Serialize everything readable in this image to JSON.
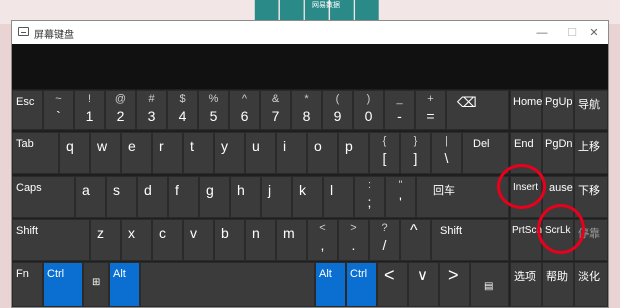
{
  "window": {
    "title": "屏幕键盘"
  },
  "backdrop": {
    "caption": "网易数据"
  },
  "icons": {
    "minimize": "minimize-icon",
    "maximize": "maximize-icon",
    "close": "close-icon",
    "backspace": "backspace-icon",
    "windows": "windows-logo-icon",
    "menu": "menu-icon"
  },
  "keys": {
    "esc": "Esc",
    "k1_top": "~",
    "k1_bot": "`",
    "k2_top": "!",
    "k2_bot": "1",
    "k3_top": "@",
    "k3_bot": "2",
    "k4_top": "#",
    "k4_bot": "3",
    "k5_top": "$",
    "k5_bot": "4",
    "k6_top": "%",
    "k6_bot": "5",
    "k7_top": "^",
    "k7_bot": "6",
    "k8_top": "&",
    "k8_bot": "7",
    "k9_top": "*",
    "k9_bot": "8",
    "k10_top": "(",
    "k10_bot": "9",
    "k11_top": ")",
    "k11_bot": "0",
    "k12_top": "_",
    "k12_bot": "-",
    "k13_top": "+",
    "k13_bot": "=",
    "backspace": "⌫",
    "home": "Home",
    "pgup": "PgUp",
    "nav": "导航",
    "tab": "Tab",
    "q": "q",
    "w": "w",
    "e": "e",
    "r": "r",
    "t": "t",
    "y": "y",
    "u": "u",
    "i": "i",
    "o": "o",
    "p": "p",
    "lbr_top": "{",
    "lbr_bot": "[",
    "rbr_top": "}",
    "rbr_bot": "]",
    "bs_top": "|",
    "bs_bot": "\\",
    "del": "Del",
    "end": "End",
    "pgdn": "PgDn",
    "moveup": "上移",
    "caps": "Caps",
    "a": "a",
    "s": "s",
    "d": "d",
    "f": "f",
    "g": "g",
    "h": "h",
    "j": "j",
    "k": "k",
    "l": "l",
    "semi_top": ":",
    "semi_bot": ";",
    "quote_top": "\"",
    "quote_bot": "'",
    "enter": "回车",
    "insert": "Insert",
    "pause": "ause",
    "movedown": "下移",
    "shift": "Shift",
    "z": "z",
    "x": "x",
    "c": "c",
    "v": "v",
    "b": "b",
    "n": "n",
    "m": "m",
    "comma_top": "<",
    "comma_bot": ",",
    "period_top": ">",
    "period_bot": ".",
    "slash_top": "?",
    "slash_bot": "/",
    "up": "^",
    "shift_r": "Shift",
    "prtscn": "PrtScn",
    "scrlk": "ScrLk",
    "dock": "停靠",
    "fn": "Fn",
    "ctrl": "Ctrl",
    "alt": "Alt",
    "alt_r": "Alt",
    "ctrl_r": "Ctrl",
    "left": "<",
    "down": "∨",
    "right": ">",
    "options": "选项",
    "help": "帮助",
    "fade": "淡化"
  }
}
